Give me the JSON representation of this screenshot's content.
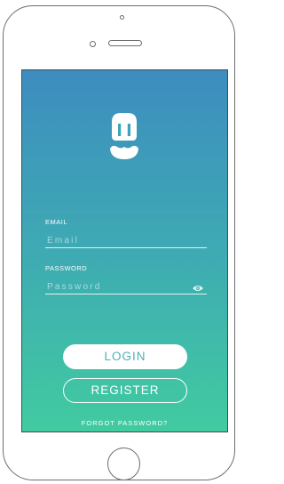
{
  "colors": {
    "gradient_top": "#3d8dbf",
    "gradient_mid": "#3eaab3",
    "gradient_bottom": "#41cba0",
    "device_outline": "#6d6d6d",
    "login_text": "#4dafb7"
  },
  "logo": {
    "icon": "plug-mustache-icon"
  },
  "form": {
    "email_label": "EMAIL",
    "email_placeholder": "Email",
    "password_label": "PASSWORD",
    "password_placeholder": "Password",
    "password_toggle_icon": "eye-icon"
  },
  "actions": {
    "login_label": "LOGIN",
    "register_label": "REGISTER",
    "forgot_label": "FORGOT PASSWORD?"
  }
}
